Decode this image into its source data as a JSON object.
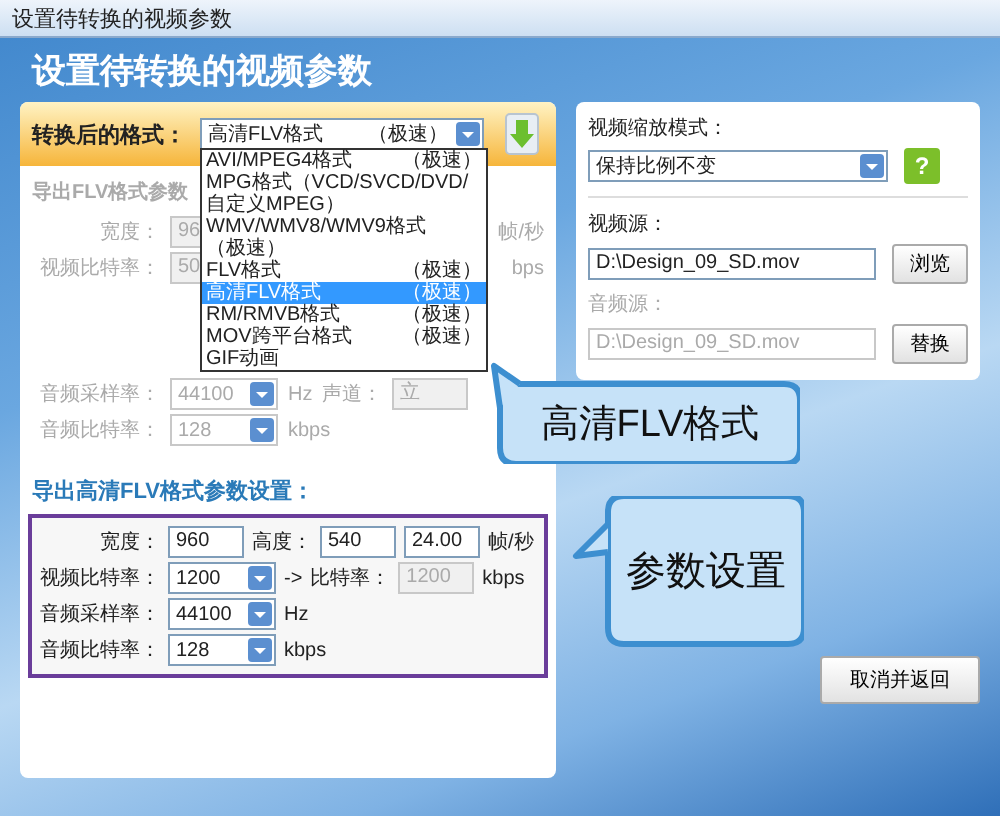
{
  "window": {
    "title": "设置待转换的视频参数"
  },
  "header": "设置待转换的视频参数",
  "format": {
    "label": "转换后的格式：",
    "value": "高清FLV格式",
    "speed": "（极速）"
  },
  "format_options": [
    {
      "name": "AVI/MPEG4格式",
      "speed": "（极速）",
      "selected": false
    },
    {
      "name": "MPG格式（VCD/SVCD/DVD/自定义MPEG）",
      "selected": false
    },
    {
      "name": "WMV/WMV8/WMV9格式",
      "speed": "（极速）",
      "selected": false
    },
    {
      "name": "FLV格式",
      "speed": "（极速）",
      "selected": false
    },
    {
      "name": "高清FLV格式",
      "speed": "（极速）",
      "selected": true
    },
    {
      "name": "RM/RMVB格式",
      "speed": "（极速）",
      "selected": false
    },
    {
      "name": "MOV跨平台格式",
      "speed": "（极速）",
      "selected": false
    },
    {
      "name": "GIF动画",
      "selected": false
    }
  ],
  "flv_section": {
    "title": "导出FLV格式参数",
    "disabled": true,
    "rows": [
      [
        {
          "kind": "label",
          "text": "宽度："
        },
        {
          "kind": "field",
          "text": "96"
        },
        {
          "kind": "far",
          "text": "帧/秒"
        }
      ],
      [
        {
          "kind": "label",
          "text": "视频比特率："
        },
        {
          "kind": "field",
          "text": "50"
        },
        {
          "kind": "far",
          "text": "bps"
        }
      ],
      [
        {
          "kind": "label",
          "text": "音频采样率："
        },
        {
          "kind": "combo",
          "text": "44100"
        },
        {
          "kind": "unit",
          "text": "Hz"
        },
        {
          "kind": "label",
          "text": "声道："
        },
        {
          "kind": "field",
          "text": "立"
        }
      ],
      [
        {
          "kind": "label",
          "text": "音频比特率："
        },
        {
          "kind": "combo",
          "text": "128"
        },
        {
          "kind": "unit",
          "text": "kbps"
        }
      ]
    ]
  },
  "hd_section": {
    "title": "导出高清FLV格式参数设置：",
    "disabled": false,
    "rows": [
      [
        {
          "kind": "label",
          "text": "宽度："
        },
        {
          "kind": "field",
          "text": "960"
        },
        {
          "kind": "label",
          "text": "高度："
        },
        {
          "kind": "field",
          "text": "540"
        },
        {
          "kind": "field",
          "text": "24.00"
        },
        {
          "kind": "unit",
          "text": "帧/秒"
        }
      ],
      [
        {
          "kind": "label",
          "text": "视频比特率："
        },
        {
          "kind": "combo",
          "text": "1200"
        },
        {
          "kind": "unit",
          "text": "->"
        },
        {
          "kind": "label",
          "text": "比特率："
        },
        {
          "kind": "field",
          "text": "1200",
          "disabled": true
        },
        {
          "kind": "unit",
          "text": "kbps"
        }
      ],
      [
        {
          "kind": "label",
          "text": "音频采样率："
        },
        {
          "kind": "combo",
          "text": "44100"
        },
        {
          "kind": "unit",
          "text": "Hz"
        }
      ],
      [
        {
          "kind": "label",
          "text": "音频比特率："
        },
        {
          "kind": "combo",
          "text": "128"
        },
        {
          "kind": "unit",
          "text": "kbps"
        }
      ]
    ]
  },
  "scale_mode": {
    "label": "视频缩放模式：",
    "value": "保持比例不变",
    "help": "?"
  },
  "video_source": {
    "label": "视频源：",
    "value": "D:\\Design_09_SD.mov",
    "button": "浏览",
    "disabled": false
  },
  "audio_source": {
    "label": "音频源：",
    "value": "D:\\Design_09_SD.mov",
    "button": "替换",
    "disabled": true
  },
  "callouts": [
    "高清FLV格式",
    "参数设置"
  ],
  "cancel_button": "取消并返回"
}
